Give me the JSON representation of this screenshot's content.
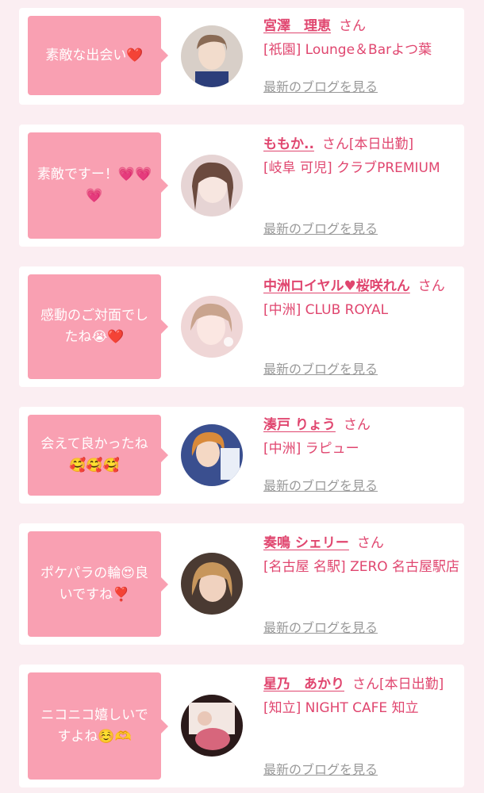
{
  "cards": [
    {
      "message": "素敵な出会い❤️",
      "name": "宮澤　理恵",
      "honorific": "さん",
      "tag": "",
      "shop": "[祇園] Lounge＆Barよつ葉",
      "blog_link": "最新のブログを見る"
    },
    {
      "message": "素敵ですー！💗💗💗",
      "name": "ももか..",
      "honorific": "さん",
      "tag": "[本日出勤]",
      "shop": "[岐阜 可児] クラブPREMIUM",
      "blog_link": "最新のブログを見る"
    },
    {
      "message": "感動のご対面でしたね😭❤️",
      "name": "中洲ロイヤル♥桜咲れん",
      "honorific": "さん",
      "tag": "",
      "shop": "[中洲] CLUB ROYAL",
      "blog_link": "最新のブログを見る"
    },
    {
      "message": "会えて良かったね🥰🥰🥰",
      "name": "湊戸 りょう",
      "honorific": "さん",
      "tag": "",
      "shop": "[中洲] ラピュー",
      "blog_link": "最新のブログを見る"
    },
    {
      "message": "ポケパラの輪😍良いですね❣️",
      "name": "奏鳴 シェリー",
      "honorific": "さん",
      "tag": "",
      "shop": "[名古屋 名駅] ZERO 名古屋駅店",
      "blog_link": "最新のブログを見る"
    },
    {
      "message": "ニコニコ嬉しいですよね☺️🫶",
      "name": "星乃　あかり",
      "honorific": "さん",
      "tag": "[本日出勤]",
      "shop": "[知立] NIGHT CAFE 知立",
      "blog_link": "最新のブログを見る"
    }
  ],
  "colors": {
    "background": "#fbeef2",
    "bubble": "#f9a0b2",
    "accent": "#e0466f",
    "link_gray": "#999999"
  }
}
